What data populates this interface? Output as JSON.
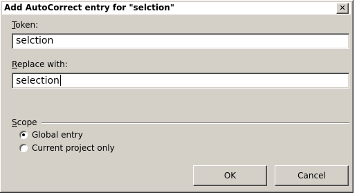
{
  "dialog": {
    "title": "Add AutoCorrect entry for \"selction\"",
    "close_glyph": "✕"
  },
  "token": {
    "label_accel": "T",
    "label_rest": "oken:",
    "value": "selction"
  },
  "replace": {
    "label_accel": "R",
    "label_rest": "eplace with:",
    "value": "selection"
  },
  "scope": {
    "label_accel": "S",
    "label_rest": "cope",
    "options": [
      {
        "label": "Global entry",
        "selected": true
      },
      {
        "label": "Current project only",
        "selected": false
      }
    ]
  },
  "buttons": {
    "ok": "OK",
    "cancel": "Cancel"
  },
  "colors": {
    "face": "#d4d0c8",
    "shadow": "#808080",
    "highlight": "#ffffff"
  }
}
